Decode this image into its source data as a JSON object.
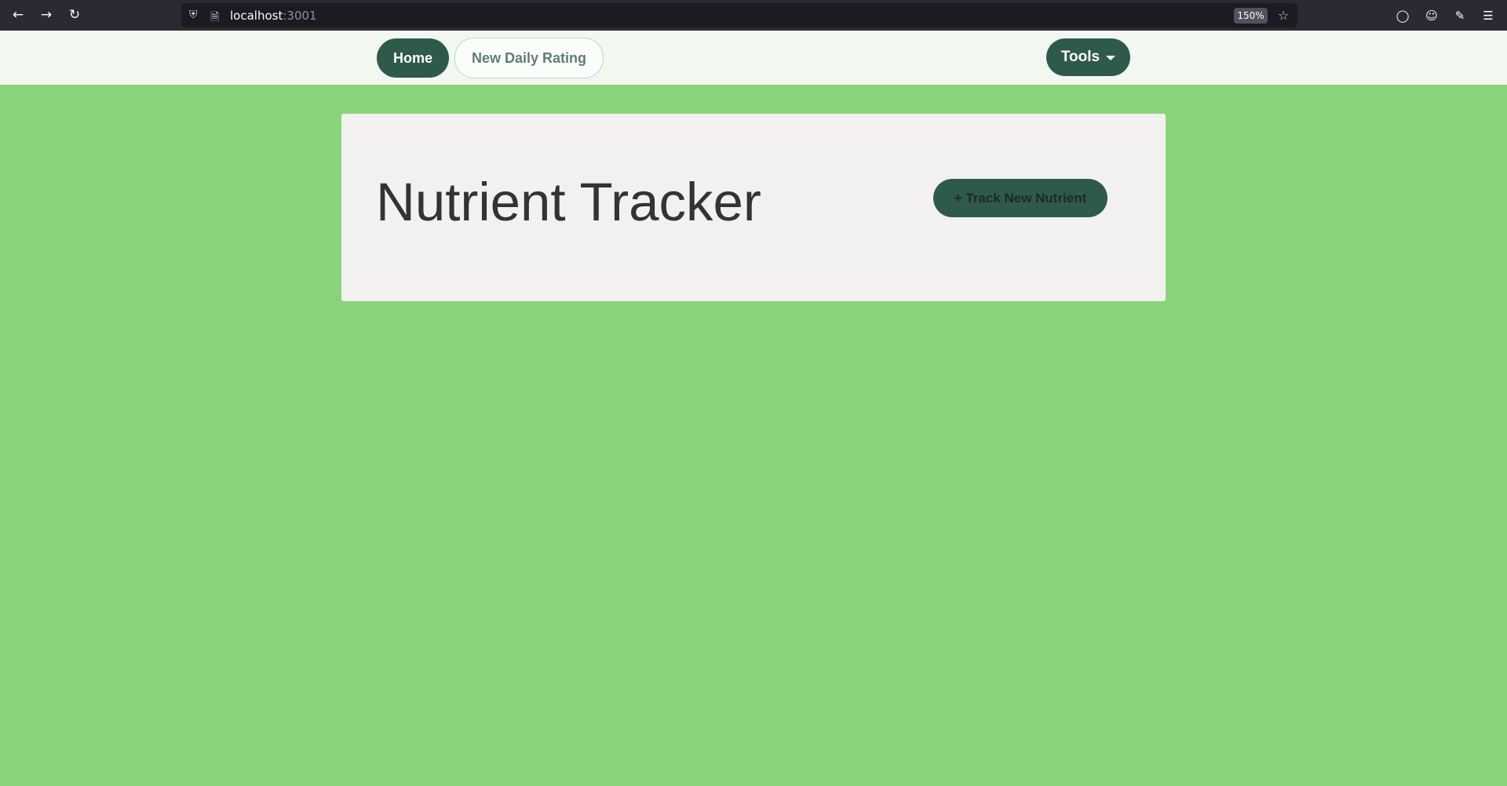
{
  "browser": {
    "url_host": "localhost",
    "url_port": ":3001",
    "zoom": "150%",
    "icons": {
      "back": "back-arrow-icon",
      "forward": "forward-arrow-icon",
      "reload": "reload-icon",
      "shield": "shield-icon",
      "page": "page-icon",
      "star": "bookmark-star-icon",
      "pocket": "pocket-icon",
      "account": "account-icon",
      "extensions": "extensions-icon",
      "menu": "hamburger-menu-icon"
    }
  },
  "nav": {
    "home_label": "Home",
    "rating_label": "New Daily Rating",
    "tools_label": "Tools"
  },
  "main": {
    "title": "Nutrient Tracker",
    "track_button_label": "+ Track New Nutrient"
  },
  "colors": {
    "page_background": "#89d47b",
    "nav_background": "#f2f7f0",
    "accent": "#2e5a4c",
    "card_background": "#f2f1ef"
  }
}
